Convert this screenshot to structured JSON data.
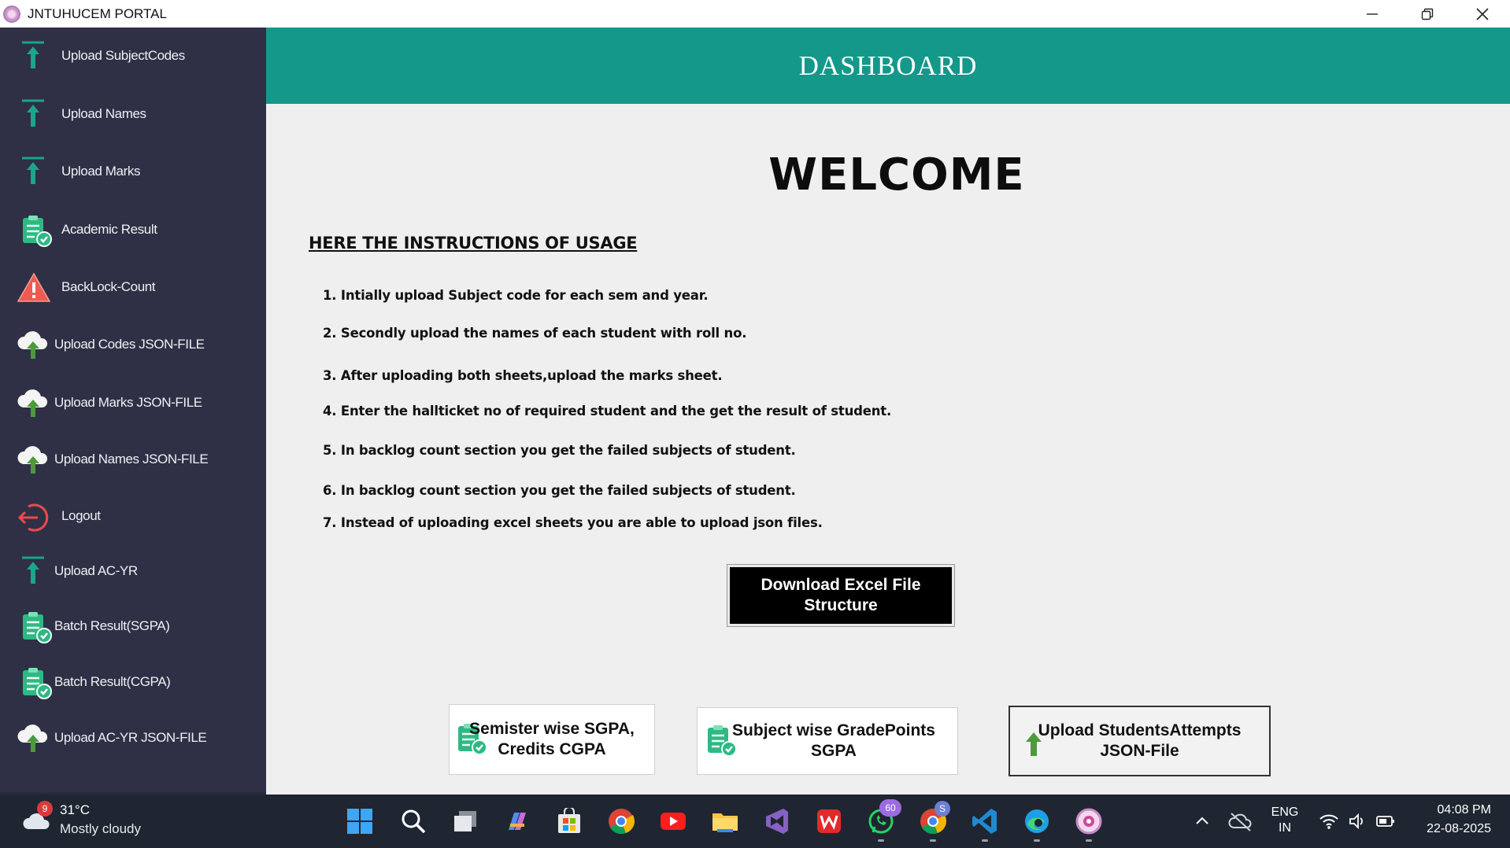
{
  "window": {
    "title": "JNTUHUCEM PORTAL"
  },
  "sidebar": {
    "items": [
      {
        "label": "Upload SubjectCodes",
        "icon": "upload-arrow-icon"
      },
      {
        "label": "Upload Names",
        "icon": "upload-arrow-icon"
      },
      {
        "label": "Upload Marks",
        "icon": "upload-arrow-icon"
      },
      {
        "label": "Academic Result",
        "icon": "clipboard-check-icon"
      },
      {
        "label": "BackLock-Count",
        "icon": "warning-icon"
      },
      {
        "label": "Upload Codes JSON-FILE",
        "icon": "cloud-upload-icon"
      },
      {
        "label": "Upload Marks JSON-FILE",
        "icon": "cloud-upload-icon"
      },
      {
        "label": "Upload Names JSON-FILE",
        "icon": "cloud-upload-icon"
      },
      {
        "label": "Logout",
        "icon": "logout-icon"
      },
      {
        "label": "Upload AC-YR",
        "icon": "upload-arrow-icon"
      },
      {
        "label": "Batch Result(SGPA)",
        "icon": "clipboard-check-icon"
      },
      {
        "label": "Batch Result(CGPA)",
        "icon": "clipboard-check-icon"
      },
      {
        "label": "Upload AC-YR JSON-FILE",
        "icon": "cloud-upload-icon"
      }
    ]
  },
  "header": {
    "title": "DASHBOARD"
  },
  "main": {
    "welcome": "WELCOME",
    "instructions_heading": "HERE THE INSTRUCTIONS OF USAGE",
    "instructions": [
      "1. Intially upload Subject code for each sem and year.",
      "2. Secondly upload the names of each student with roll no.",
      "3. After uploading both sheets,upload the marks sheet.",
      "4. Enter the hallticket no of required student and the get the result of student.",
      "5. In backlog count section you get the failed subjects of student.",
      "6. In backlog count section you get the failed subjects of student.",
      "7. Instead of uploading excel sheets you are able to upload json files."
    ],
    "download_button": {
      "line1": "Download Excel File",
      "line2": "Structure"
    },
    "semester_button": {
      "line1": "Semister wise SGPA,",
      "line2": "Credits  CGPA"
    },
    "subject_button": {
      "line1": "Subject wise GradePoints",
      "line2": "SGPA"
    },
    "attempts_button": {
      "line1": "Upload StudentsAttempts",
      "line2": "JSON-File"
    }
  },
  "taskbar": {
    "weather": {
      "temp": "31°C",
      "desc": "Mostly cloudy",
      "badge": "9"
    },
    "whatsapp_badge": "60",
    "chrome_profile_badge": "S",
    "language": {
      "line1": "ENG",
      "line2": "IN"
    },
    "clock": {
      "time": "04:08 PM",
      "date": "22-08-2025"
    }
  },
  "colors": {
    "sidebar": "#2f3045",
    "header": "#14988a",
    "main_bg": "#efefef",
    "taskbar": "#1f2631"
  }
}
